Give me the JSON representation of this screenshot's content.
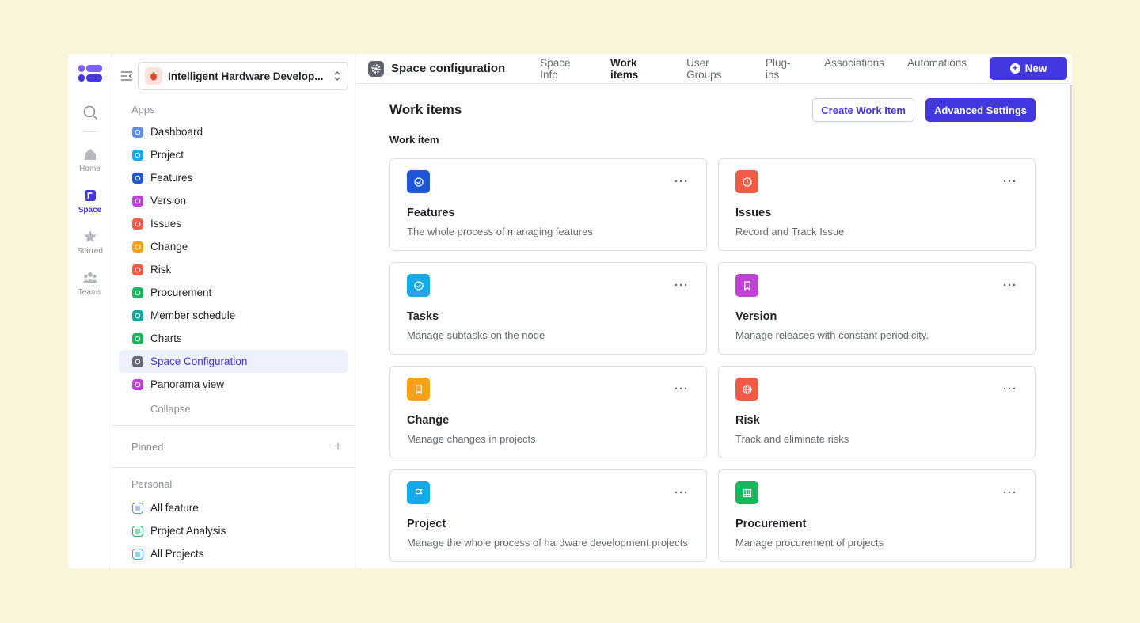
{
  "rail": {
    "items": [
      {
        "label": "Home"
      },
      {
        "label": "Space"
      },
      {
        "label": "Starred"
      },
      {
        "label": "Teams"
      }
    ]
  },
  "sidebar": {
    "space_name": "Intelligent Hardware Develop...",
    "apps_title": "Apps",
    "apps": [
      {
        "label": "Dashboard",
        "color": "#5b8def"
      },
      {
        "label": "Project",
        "color": "#14a9e8"
      },
      {
        "label": "Features",
        "color": "#1d57d8"
      },
      {
        "label": "Version",
        "color": "#c041d6"
      },
      {
        "label": "Issues",
        "color": "#f15a45"
      },
      {
        "label": "Change",
        "color": "#f7a11a"
      },
      {
        "label": "Risk",
        "color": "#f15a45"
      },
      {
        "label": "Procurement",
        "color": "#17b75b"
      },
      {
        "label": "Member schedule",
        "color": "#11a89b"
      },
      {
        "label": "Charts",
        "color": "#17b75b"
      },
      {
        "label": "Space Configuration",
        "color": "#646a73"
      },
      {
        "label": "Panorama view",
        "color": "#c041d6"
      }
    ],
    "collapse_label": "Collapse",
    "pinned_title": "Pinned",
    "personal_title": "Personal",
    "personal": [
      {
        "label": "All feature",
        "color": "#5b8def"
      },
      {
        "label": "Project Analysis",
        "color": "#17b75b"
      },
      {
        "label": "All Projects",
        "color": "#14a9e8"
      }
    ]
  },
  "topbar": {
    "title": "Space configuration",
    "tabs": [
      "Space Info",
      "Work items",
      "User Groups",
      "Plug-ins",
      "Associations",
      "Automations"
    ],
    "active_tab": "Work items",
    "new_label": "New"
  },
  "content": {
    "title": "Work items",
    "create_label": "Create Work Item",
    "advanced_label": "Advanced Settings",
    "section_label": "Work item",
    "cards": [
      {
        "name": "Features",
        "desc": "The whole process of managing features",
        "color": "#1d57d8",
        "icon": "check-circle-icon"
      },
      {
        "name": "Issues",
        "desc": "Record and Track Issue",
        "color": "#f15a45",
        "icon": "alert-icon"
      },
      {
        "name": "Tasks",
        "desc": "Manage subtasks on the node",
        "color": "#14a9e8",
        "icon": "check-circle-icon"
      },
      {
        "name": "Version",
        "desc": "Manage releases with constant periodicity.",
        "color": "#c041d6",
        "icon": "bookmark-icon"
      },
      {
        "name": "Change",
        "desc": "Manage changes in projects",
        "color": "#f7a11a",
        "icon": "bookmark-icon"
      },
      {
        "name": "Risk",
        "desc": "Track and eliminate risks",
        "color": "#f15a45",
        "icon": "globe-icon"
      },
      {
        "name": "Project",
        "desc": "Manage the whole process of hardware development projects",
        "color": "#14a9e8",
        "icon": "flag-icon"
      },
      {
        "name": "Procurement",
        "desc": "Manage procurement of projects",
        "color": "#17b75b",
        "icon": "table-icon"
      }
    ]
  }
}
